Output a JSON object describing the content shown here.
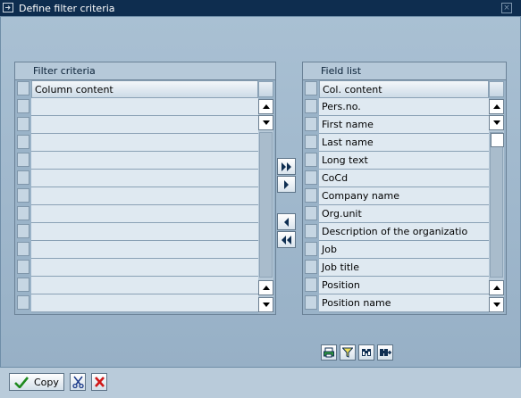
{
  "window": {
    "title": "Define filter criteria",
    "close_glyph": "×"
  },
  "left_panel": {
    "title": "Filter criteria",
    "column_header": "Column content",
    "rows": [
      "",
      "",
      "",
      "",
      "",
      "",
      "",
      "",
      "",
      "",
      "",
      ""
    ]
  },
  "right_panel": {
    "title": "Field list",
    "column_header": "Col. content",
    "rows": [
      "Pers.no.",
      "First name",
      "Last name",
      "Long text",
      "CoCd",
      "Company name",
      "Org.unit",
      "Description of the organizatio",
      "Job",
      "Job title",
      "Position",
      "Position name"
    ]
  },
  "transfer_buttons": [
    "add-all-icon",
    "add-selected-icon",
    "remove-selected-icon",
    "remove-all-icon"
  ],
  "toolbar_icons": [
    "print-icon",
    "filter-icon",
    "find-icon",
    "find-next-icon"
  ],
  "footer": {
    "copy_label": "Copy"
  },
  "colors": {
    "title_bar": "#0e2d4f",
    "background": "#9fb8cc",
    "cell": "#dfe9f1",
    "confirm": "#1f8a1f",
    "cancel": "#d01818"
  }
}
